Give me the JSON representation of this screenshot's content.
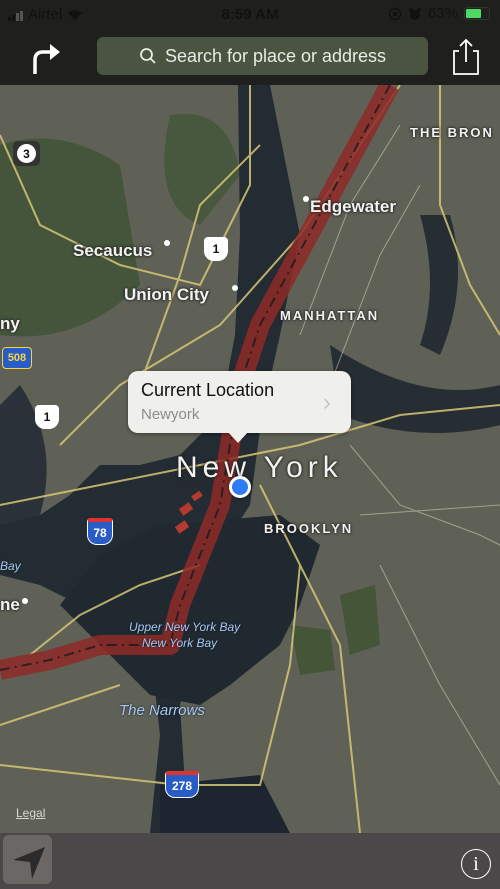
{
  "status_bar": {
    "carrier": "Airtel",
    "time": "8:59 AM",
    "battery_percent": "63%",
    "icons": [
      "signal-icon",
      "wifi-icon",
      "orientation-lock-icon",
      "alarm-icon",
      "battery-charging-icon"
    ]
  },
  "toolbar": {
    "directions_icon": "turn-right-arrow-icon",
    "search_placeholder": "Search for place or address",
    "share_icon": "share-icon"
  },
  "map": {
    "type": "satellite",
    "labels": {
      "bronx": "THE BRON",
      "edgewater": "Edgewater",
      "secaucus": "Secaucus",
      "union_city": "Union City",
      "manhattan": "MANHATTAN",
      "kearny": "ny",
      "new_york": "New York",
      "brooklyn": "BROOKLYN",
      "bay_left": "Bay",
      "bayonne": "ne",
      "upper_bay": "Upper New York Bay",
      "ny_bay": "New York Bay",
      "narrows": "The Narrows"
    },
    "shields": {
      "route3": "3",
      "us1_top": "1",
      "us1_left": "1",
      "cr508": "508",
      "i78": "78",
      "i278": "278"
    },
    "route_color": "#8e2a28",
    "callout": {
      "title": "Current Location",
      "subtitle": "Newyork"
    },
    "legal": "Legal"
  },
  "bottom_bar": {
    "tracking_icon": "location-arrow-icon",
    "info_icon": "info-icon"
  }
}
